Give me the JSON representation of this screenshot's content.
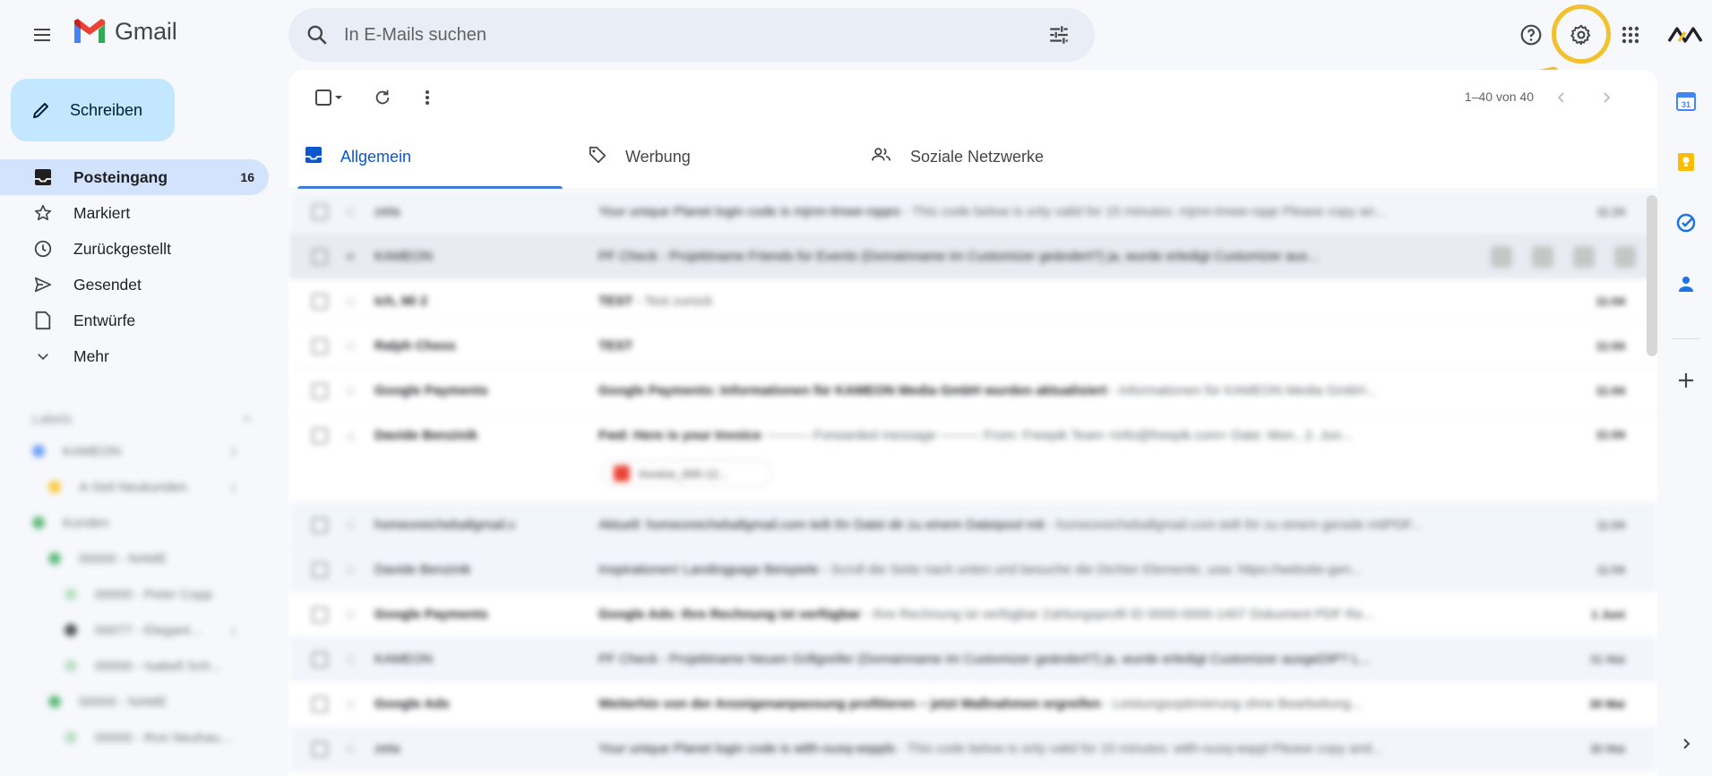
{
  "app": {
    "name": "Gmail"
  },
  "search": {
    "placeholder": "In E-Mails suchen"
  },
  "compose": {
    "label": "Schreiben"
  },
  "nav": [
    {
      "label": "Posteingang",
      "count": "16",
      "icon": "inbox-icon",
      "active": true
    },
    {
      "label": "Markiert",
      "count": "",
      "icon": "star-icon"
    },
    {
      "label": "Zurückgestellt",
      "count": "",
      "icon": "clock-icon"
    },
    {
      "label": "Gesendet",
      "count": "",
      "icon": "send-icon"
    },
    {
      "label": "Entwürfe",
      "count": "",
      "icon": "draft-icon"
    },
    {
      "label": "Mehr",
      "count": "",
      "icon": "chevron-down-icon"
    }
  ],
  "labels": {
    "header": "Labels",
    "items": [
      {
        "name": "KAMEON",
        "count": "3",
        "color": "#4285f4"
      },
      {
        "name": "A-Seil Neukunden",
        "count": "1",
        "color": "#fbbc04"
      },
      {
        "name": "Kunden",
        "count": "",
        "color": "#34a853"
      },
      {
        "name": "00000 - NAME",
        "count": "",
        "color": "#34a853"
      },
      {
        "name": "00000 - Peter Copp",
        "count": "",
        "color": "#a8dab5"
      },
      {
        "name": "00077 - Elegant...",
        "count": "1",
        "color": "#202124"
      },
      {
        "name": "00000 - Isabell Sch...",
        "count": "",
        "color": "#a8dab5"
      },
      {
        "name": "00000 - NAME",
        "count": "",
        "color": "#34a853"
      },
      {
        "name": "00000 - Ron Neuhau...",
        "count": "",
        "color": "#a8dab5"
      }
    ]
  },
  "toolbar": {
    "pager": "1–40 von 40"
  },
  "tabs": [
    {
      "label": "Allgemein",
      "icon": "inbox-tab-icon",
      "active": true
    },
    {
      "label": "Werbung",
      "icon": "tag-icon"
    },
    {
      "label": "Soziale Netzwerke",
      "icon": "people-icon"
    }
  ],
  "emails": [
    {
      "sender": "zeta",
      "subject": "Your unique Planet login code is mjmn-lmwe-rqqes",
      "snippet": " - This code below is only valid for 15 minutes: mjmn-lmwe-rqqe Please copy an...",
      "date": "11:24",
      "read": true
    },
    {
      "sender": "KAMEON",
      "subject": "PF Check - Projektname Friends for Events (Domainname im Customizer geändert?) ja, wurde erledigt Customizer aus...",
      "snippet": "",
      "date": "",
      "read": true,
      "hover": true
    },
    {
      "sender": "Ich, Mi 2",
      "subject": "TEST",
      "snippet": " - Test zurück",
      "date": "11:04",
      "read": false
    },
    {
      "sender": "Ralph Chess",
      "subject": "TEST",
      "snippet": "",
      "date": "11:04",
      "read": false
    },
    {
      "sender": "Google Payments",
      "subject": "Google Payments: Informationen für KAMEON Media GmbH wurden aktualisiert",
      "snippet": " - Informationen für KAMEON Media GmbH...",
      "date": "11:04",
      "read": false
    },
    {
      "sender": "Davide Benzinik",
      "subject": "Fwd: Here is your Invoice",
      "snippet": " ---------- Forwarded message --------- From: Freepik Team <info@freepik.com> Date: Mon., 2. Jun...",
      "date": "11:04",
      "read": false,
      "tall": true,
      "attachment": "Invoice_000-12..."
    },
    {
      "sender": "homeoreicheballgmail.c",
      "subject": "Aktuell: homeoreicheballgmail.com teilt Ihr Datei dir zu einem Dateipool mit",
      "snippet": " - homeoreicheballgmail.com teilt Ihr zu einem gerade mitPDF...",
      "date": "11:04",
      "read": true
    },
    {
      "sender": "Davide Benzinik",
      "subject": "Inspirationen! Landingpage Beispiele",
      "snippet": " - Scroll die Seite nach unten und besuche die Dichter Elemente, usw. https://website-gen...",
      "date": "11:04",
      "read": true
    },
    {
      "sender": "Google Payments",
      "subject": "Google Ads: Ihre Rechnung ist verfügbar",
      "snippet": " - Ihre Rechnung ist verfügbar Zahlungsprofil ID 0000-0000-1407 Dokument PDF Re...",
      "date": "1 Juni",
      "read": false
    },
    {
      "sender": "KAMEON",
      "subject": "PF Check - Projektname Neuen Grillgreifer (Domainname im Customizer geändert?) ja, wurde erledigt Customizer ausgeDIP? L...",
      "snippet": "",
      "date": "31 Mai",
      "read": true
    },
    {
      "sender": "Google Ads",
      "subject": "Weiterhin von der Anzeigenanpassung profitieren – jetzt Maßnahmen ergreifen",
      "snippet": " - Leistungsoptimierung ohne Bearbeitung...",
      "date": "30 Mai",
      "read": false
    },
    {
      "sender": "zeta",
      "subject": "Your unique Planet login code is wtth-ousq-wqqds",
      "snippet": " - This code below is only valid for 15 minutes: wtth-ousq-wqqd Please copy and...",
      "date": "30 Mai",
      "read": true
    }
  ],
  "colors": {
    "accent": "#0b57d0",
    "highlight": "#f2c12e",
    "compose_bg": "#c2e7ff",
    "active_nav": "#d3e3fd"
  }
}
